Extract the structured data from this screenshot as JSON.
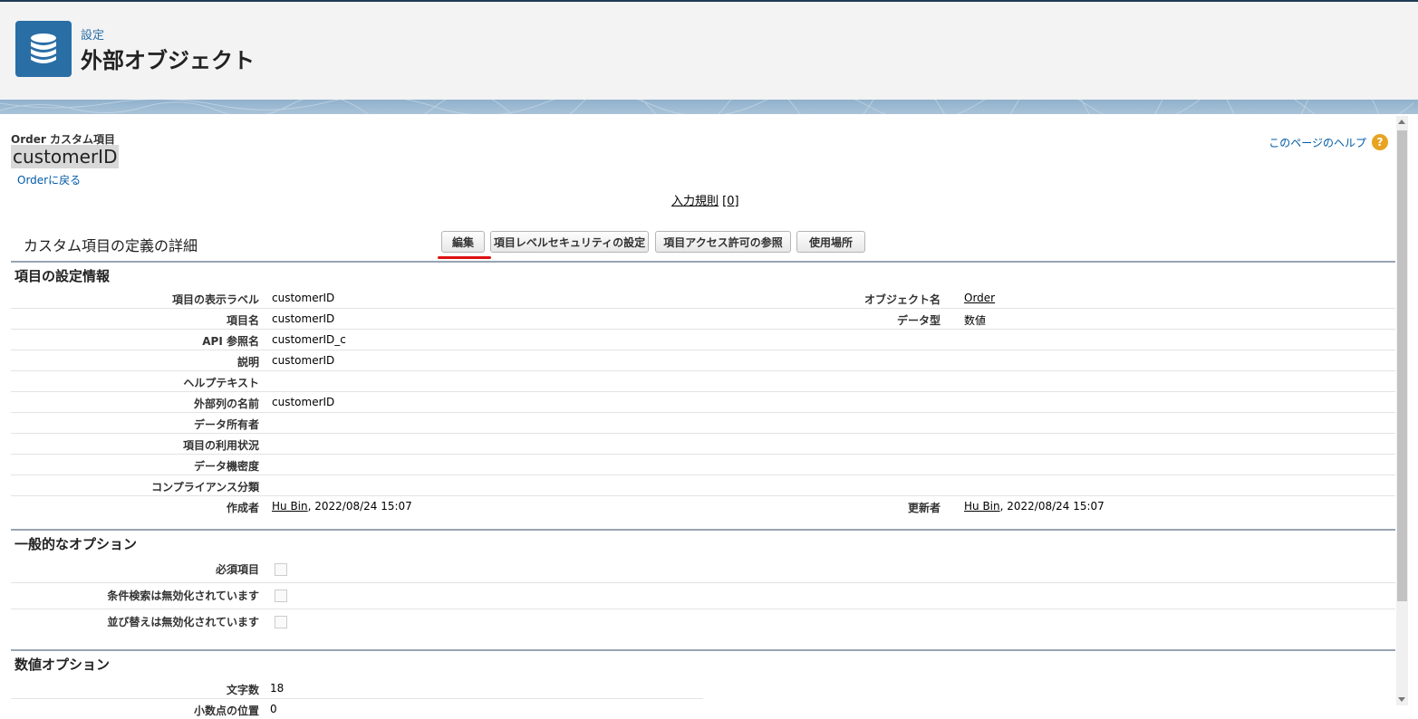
{
  "header": {
    "breadcrumb": "設定",
    "title": "外部オブジェクト"
  },
  "record": {
    "object_label": "Order カスタム項目",
    "name": "customerID",
    "back_link": "Orderに戻る",
    "help_link": "このページのヘルプ",
    "help_icon": "?"
  },
  "related": {
    "rules_label": "入力規則",
    "rules_count": "[0]"
  },
  "detail": {
    "title": "カスタム項目の定義の詳細",
    "buttons": {
      "edit": "編集",
      "fls": "項目レベルセキュリティの設定",
      "access": "項目アクセス許可の参照",
      "where_used": "使用場所"
    }
  },
  "sections": {
    "info": "項目の設定情報",
    "general": "一般的なオプション",
    "number": "数値オプション"
  },
  "info_rows": [
    {
      "label": "項目の表示ラベル",
      "value": "customerID",
      "label2": "オブジェクト名",
      "value2": "Order"
    },
    {
      "label": "項目名",
      "value": "customerID",
      "label2": "データ型",
      "value2": "数値"
    },
    {
      "label": "API 参照名",
      "value": "customerID_c"
    },
    {
      "label": "説明",
      "value": "customerID"
    },
    {
      "label": "ヘルプテキスト",
      "value": ""
    },
    {
      "label": "外部列の名前",
      "value": "customerID"
    },
    {
      "label": "データ所有者",
      "value": ""
    },
    {
      "label": "項目の利用状況",
      "value": ""
    },
    {
      "label": "データ機密度",
      "value": ""
    },
    {
      "label": "コンプライアンス分類",
      "value": ""
    },
    {
      "label": "作成者",
      "value_link": "Hu Bin",
      "value_rest": ", 2022/08/24 15:07",
      "label2": "更新者",
      "value2_link": "Hu Bin",
      "value2_rest": ", 2022/08/24 15:07"
    }
  ],
  "general_rows": [
    {
      "label": "必須項目",
      "checked": false
    },
    {
      "label": "条件検索は無効化されています",
      "checked": false
    },
    {
      "label": "並び替えは無効化されています",
      "checked": false
    }
  ],
  "number_rows": [
    {
      "label": "文字数",
      "value": "18"
    },
    {
      "label": "小数点の位置",
      "value": "0"
    }
  ],
  "colors": {
    "brand": "#2a6ea6",
    "link": "#015ba7",
    "highlight": "#dd1111"
  }
}
